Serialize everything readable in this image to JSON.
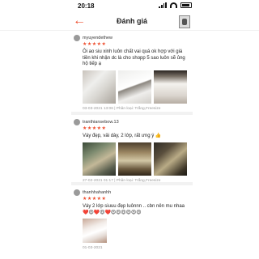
{
  "status": {
    "time": "20:18"
  },
  "header": {
    "title": "Đánh giá"
  },
  "reviews": [
    {
      "username": "myuyendethew",
      "stars": "★★★★★",
      "text": "Ôi ao siu xinh luôn chất vai quá ok hợp với giá tiền khi nhận dc là cho shopp 5 sao luôn sẽ ủng hộ tiếp ạ",
      "meta": "03-03-2021 13:06 | Phân loại: Trắng,Freesize"
    },
    {
      "username": "tranthiansebow.13",
      "stars": "★★★★★",
      "text": "Váy đẹp, vải dày, 2 lớp, rất ưng ý 👍",
      "meta": "27-02-2021 01:17 | Phân loại: Trắng,Freesize"
    },
    {
      "username": "thanhhahanhh",
      "stars": "★★★★★",
      "text": "Váy 2 lớp siuuu đẹp luônnn .. cbn nên mu nhaa ❤️😍❤️😍❤️😍😍😍😍😍😍",
      "meta": "01-03-2021"
    }
  ]
}
